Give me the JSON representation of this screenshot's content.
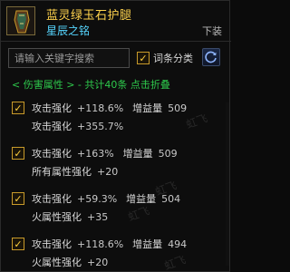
{
  "header": {
    "title": "蓝灵绿玉石护腿",
    "subtitle": "星辰之铭",
    "slot": "下装"
  },
  "search": {
    "placeholder": "请输入关键字搜索",
    "toggle_label": "词条分类"
  },
  "summary": "< 伤害属性 > - 共计40条 点击折叠",
  "entries": [
    {
      "line1_name": "攻击强化",
      "line1_value": "+118.6%",
      "gain_label": "增益量",
      "gain_value": "509",
      "line2_name": "攻击强化",
      "line2_value": "+355.7%"
    },
    {
      "line1_name": "攻击强化",
      "line1_value": "+163%",
      "gain_label": "增益量",
      "gain_value": "509",
      "line2_name": "所有属性强化",
      "line2_value": "+20"
    },
    {
      "line1_name": "攻击强化",
      "line1_value": "+59.3%",
      "gain_label": "增益量",
      "gain_value": "504",
      "line2_name": "火属性强化",
      "line2_value": "+35"
    },
    {
      "line1_name": "攻击强化",
      "line1_value": "+118.6%",
      "gain_label": "增益量",
      "gain_value": "494",
      "line2_name": "火属性强化",
      "line2_value": "+20"
    }
  ],
  "watermarks": [
    "虹飞",
    "虹飞",
    "虹飞",
    "虹飞"
  ],
  "colors": {
    "title": "#ffd34d",
    "subtitle": "#56d6ff",
    "summary": "#2ec94c",
    "checkbox_border": "#c89a2a"
  },
  "icons": {
    "item_icon": "leg-armor-icon",
    "check": "check-icon",
    "refresh": "refresh-icon"
  }
}
